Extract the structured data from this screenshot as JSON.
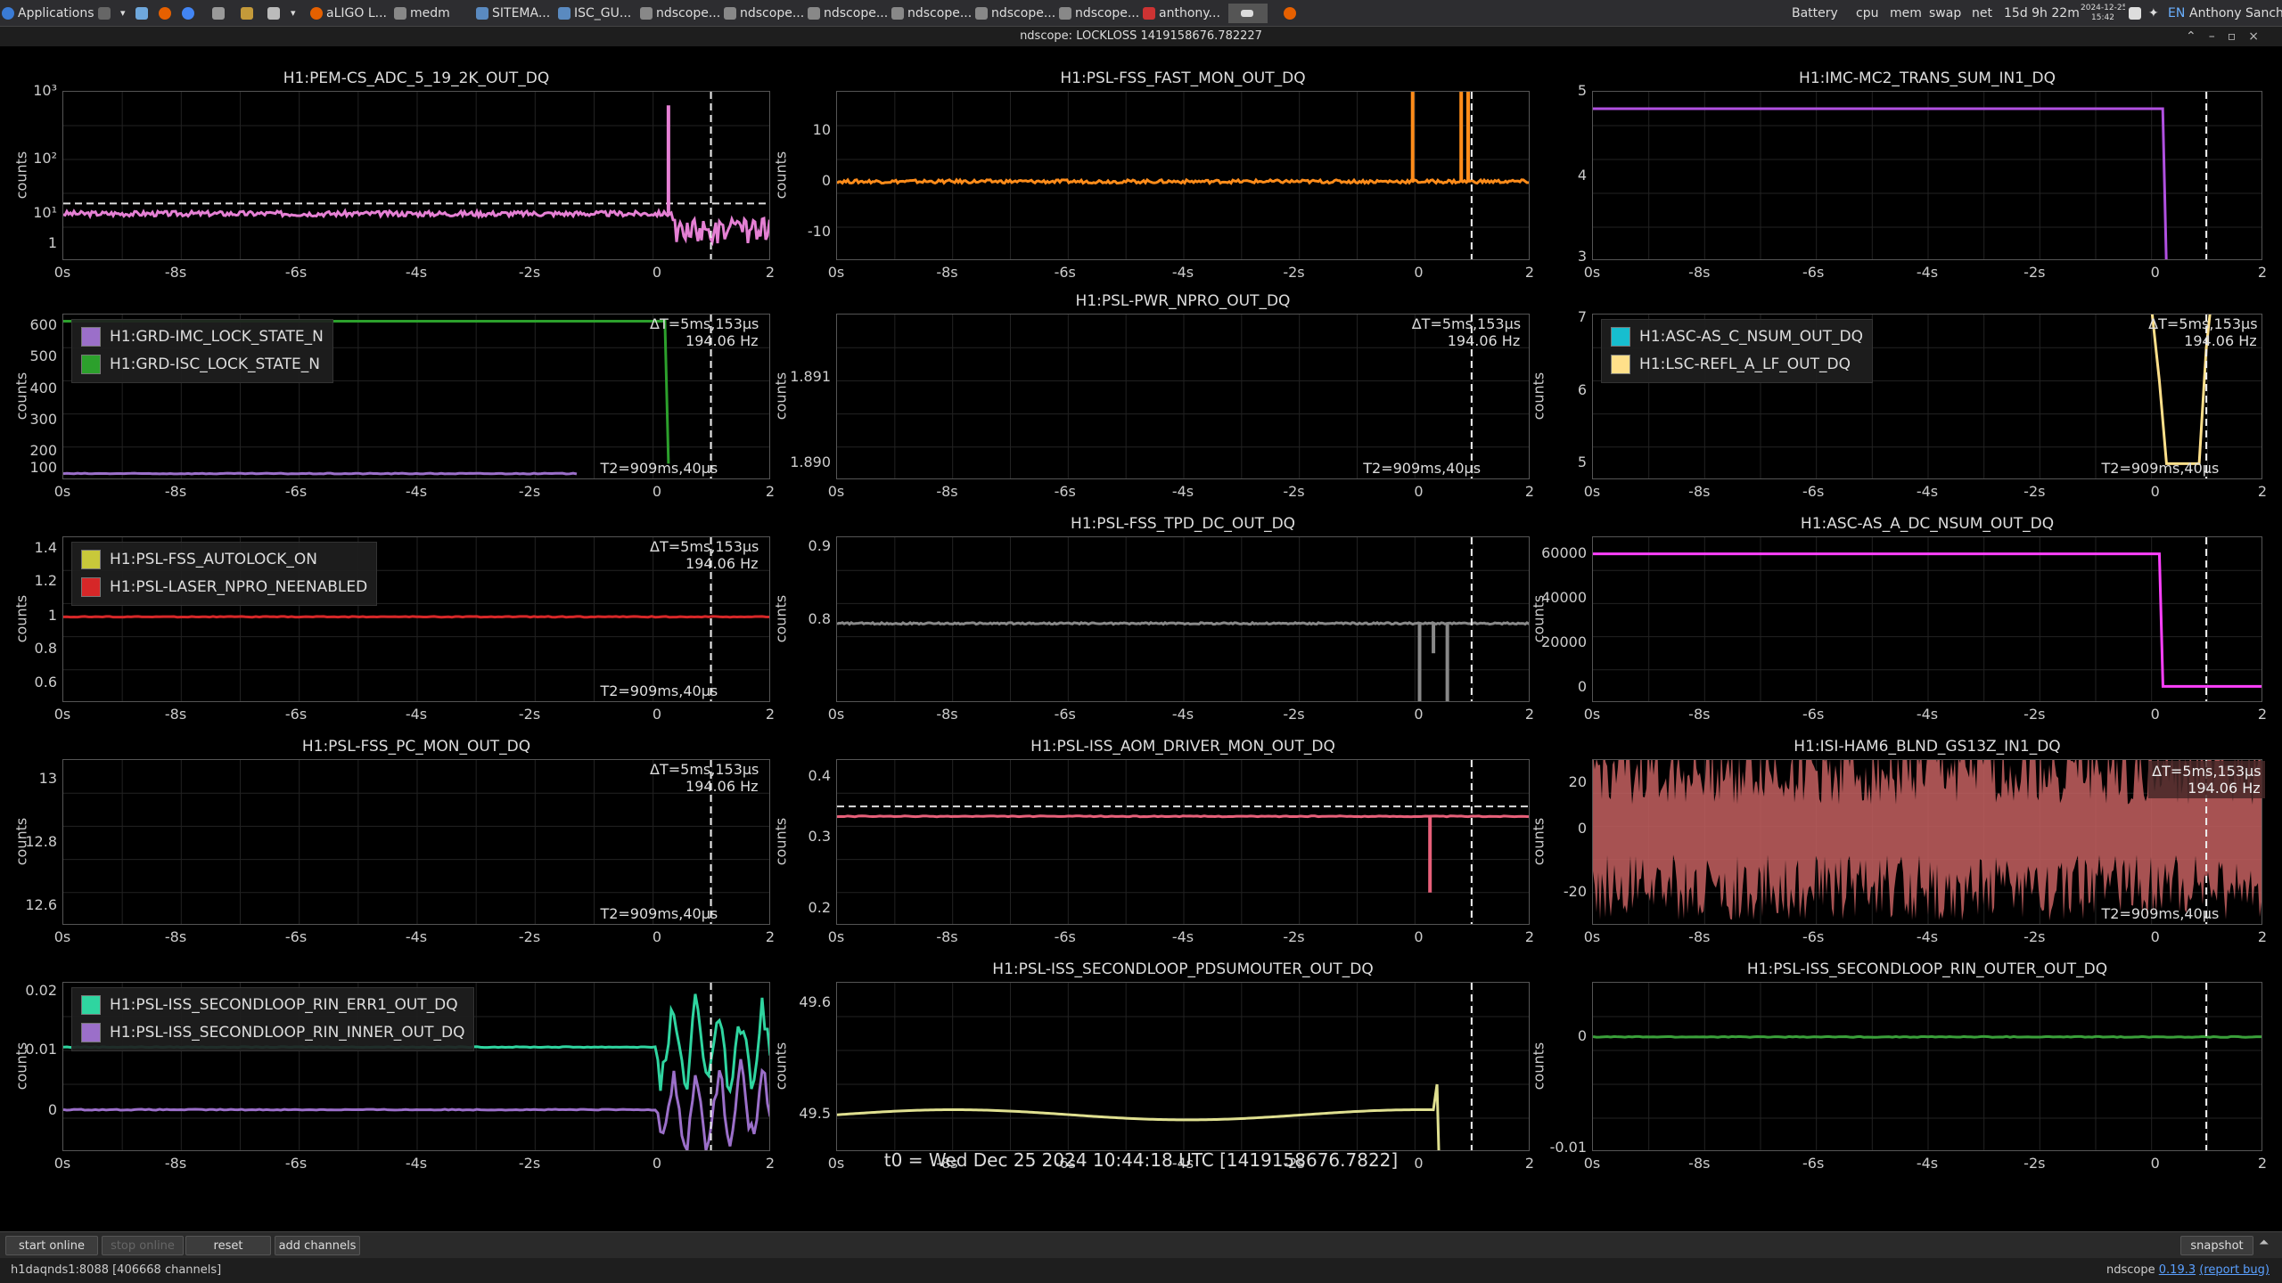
{
  "taskbar": {
    "applications": "Applications",
    "tabs": [
      "aLIGO L...",
      "medm",
      "SITEMA...",
      "ISC_GU...",
      "ndscope...",
      "ndscope...",
      "ndscope...",
      "ndscope...",
      "ndscope...",
      "ndscope...",
      "anthony..."
    ],
    "indicators": [
      "Battery",
      "cpu",
      "mem",
      "swap",
      "net"
    ],
    "uptime": "15d 9h 22m",
    "date": "2024-12-25",
    "time": "15:42",
    "lang": "EN",
    "user": "Anthony Sanchez"
  },
  "window": {
    "title": "ndscope: LOCKLOSS 1419158676.782227"
  },
  "xaxis": {
    "ticks": [
      "0s",
      "-8s",
      "-6s",
      "-4s",
      "-2s",
      "0",
      "2"
    ]
  },
  "cursor": {
    "dt": "ΔT=",
    "dt_val": "5ms,153μs",
    "freq": "194.06 Hz",
    "t2": "T2=909ms,40μs"
  },
  "plots": [
    {
      "id": "p00",
      "title": "H1:PEM-CS_ADC_5_19_2K_OUT_DQ",
      "ylabel": "counts",
      "yticks": [
        {
          "v": 1,
          "t": "10³"
        },
        {
          "v": 0.6,
          "t": "10²"
        },
        {
          "v": 0.28,
          "t": "10¹"
        },
        {
          "v": 0.1,
          "t": "1"
        }
      ],
      "series": [
        {
          "color": "#e580d4",
          "kind": "noise",
          "y": 0.28,
          "amp": 0.03,
          "after": "block",
          "block": [
            0.18,
            0.02
          ],
          "spike": [
            {
              "x": 0.855,
              "to": 0.92
            }
          ]
        }
      ],
      "hline": 0.34
    },
    {
      "id": "p01",
      "title": "H1:PSL-FSS_FAST_MON_OUT_DQ",
      "ylabel": "counts",
      "yticks": [
        {
          "v": 0.77,
          "t": "10"
        },
        {
          "v": 0.47,
          "t": "0"
        },
        {
          "v": 0.17,
          "t": "-10"
        }
      ],
      "series": [
        {
          "color": "#ff8c1a",
          "kind": "noise",
          "y": 0.47,
          "amp": 0.02,
          "spike": [
            {
              "x": 0.83,
              "to": 1
            },
            {
              "x": 0.9,
              "to": 1
            },
            {
              "x": 0.91,
              "to": 1
            }
          ]
        }
      ]
    },
    {
      "id": "p02",
      "title": "H1:IMC-MC2_TRANS_SUM_IN1_DQ",
      "ylabel": "",
      "yticks": [
        {
          "v": 1,
          "t": "5"
        },
        {
          "v": 0.5,
          "t": "4"
        },
        {
          "v": 0.02,
          "t": "3"
        }
      ],
      "series": [
        {
          "color": "#b050e0",
          "kind": "step",
          "y": 0.9,
          "dropX": 0.85,
          "dropTo": 0
        }
      ]
    },
    {
      "id": "p10",
      "title": "",
      "ylabel": "counts",
      "yticks": [
        {
          "v": 0.93,
          "t": "600"
        },
        {
          "v": 0.74,
          "t": "500"
        },
        {
          "v": 0.55,
          "t": "400"
        },
        {
          "v": 0.36,
          "t": "300"
        },
        {
          "v": 0.17,
          "t": "200"
        },
        {
          "v": 0.07,
          "t": "100"
        }
      ],
      "legend": [
        {
          "color": "#9b6fc9",
          "name": "H1:GRD-IMC_LOCK_STATE_N"
        },
        {
          "color": "#2ca02c",
          "name": "H1:GRD-ISC_LOCK_STATE_N"
        }
      ],
      "series": [
        {
          "color": "#2ca02c",
          "kind": "step",
          "y": 0.96,
          "dropX": 0.85,
          "dropTo": 0.1,
          "end": 0.9
        },
        {
          "color": "#9b6fc9",
          "kind": "flat",
          "y": 0.04,
          "end": 0.73
        }
      ]
    },
    {
      "id": "p11",
      "title": "H1:PSL-PWR_NPRO_OUT_DQ",
      "ylabel": "counts",
      "yticks": [
        {
          "v": 0.62,
          "t": "1.891"
        },
        {
          "v": 0.1,
          "t": "1.890"
        }
      ],
      "series": []
    },
    {
      "id": "p12",
      "title": "",
      "ylabel": "counts",
      "yticks": [
        {
          "v": 0.98,
          "t": "7"
        },
        {
          "v": 0.54,
          "t": "6"
        },
        {
          "v": 0.1,
          "t": "5"
        }
      ],
      "legend": [
        {
          "color": "#17becf",
          "name": "H1:ASC-AS_C_NSUM_OUT_DQ"
        },
        {
          "color": "#ffe08a",
          "name": "H1:LSC-REFL_A_LF_OUT_DQ"
        }
      ],
      "series": [
        {
          "color": "#ffe08a",
          "kind": "dip",
          "x1": 0.845,
          "x2": 0.915
        }
      ]
    },
    {
      "id": "p20",
      "title": "",
      "ylabel": "counts",
      "yticks": [
        {
          "v": 0.93,
          "t": "1.4"
        },
        {
          "v": 0.73,
          "t": "1.2"
        },
        {
          "v": 0.52,
          "t": "1"
        },
        {
          "v": 0.32,
          "t": "0.8"
        },
        {
          "v": 0.12,
          "t": "0.6"
        }
      ],
      "legend": [
        {
          "color": "#c8c83a",
          "name": "H1:PSL-FSS_AUTOLOCK_ON"
        },
        {
          "color": "#d62728",
          "name": "H1:PSL-LASER_NPRO_NEENABLED"
        }
      ],
      "series": [
        {
          "color": "#d62728",
          "kind": "flat",
          "y": 0.52,
          "end": 1
        }
      ]
    },
    {
      "id": "p21",
      "title": "H1:PSL-FSS_TPD_DC_OUT_DQ",
      "ylabel": "counts",
      "yticks": [
        {
          "v": 0.94,
          "t": "0.9"
        },
        {
          "v": 0.5,
          "t": "0.8"
        }
      ],
      "series": [
        {
          "color": "#888888",
          "kind": "noise",
          "y": 0.48,
          "amp": 0.01,
          "spike": [
            {
              "x": 0.84,
              "to": 0.0
            },
            {
              "x": 0.86,
              "to": 0.3
            },
            {
              "x": 0.88,
              "to": 0.0
            }
          ]
        }
      ]
    },
    {
      "id": "p22",
      "title": "H1:ASC-AS_A_DC_NSUM_OUT_DQ",
      "ylabel": "counts",
      "yticks": [
        {
          "v": 0.9,
          "t": "60000"
        },
        {
          "v": 0.63,
          "t": "40000"
        },
        {
          "v": 0.36,
          "t": "20000"
        },
        {
          "v": 0.09,
          "t": "0"
        }
      ],
      "series": [
        {
          "color": "#ff40ff",
          "kind": "step",
          "y": 0.9,
          "dropX": 0.845,
          "dropTo": 0.1
        }
      ]
    },
    {
      "id": "p30",
      "title": "H1:PSL-FSS_PC_MON_OUT_DQ",
      "ylabel": "counts",
      "yticks": [
        {
          "v": 0.88,
          "t": "13"
        },
        {
          "v": 0.5,
          "t": "12.8"
        },
        {
          "v": 0.12,
          "t": "12.6"
        }
      ],
      "series": []
    },
    {
      "id": "p31",
      "title": "H1:PSL-ISS_AOM_DRIVER_MON_OUT_DQ",
      "ylabel": "counts",
      "yticks": [
        {
          "v": 0.9,
          "t": "0.4"
        },
        {
          "v": 0.53,
          "t": "0.3"
        },
        {
          "v": 0.1,
          "t": "0.2"
        }
      ],
      "series": [
        {
          "color": "#e8607a",
          "kind": "flat",
          "y": 0.66,
          "end": 1,
          "spike": [
            {
              "x": 0.855,
              "to": 0.2
            }
          ]
        }
      ],
      "hline": 0.72
    },
    {
      "id": "p32",
      "title": "H1:ISI-HAM6_BLND_GS13Z_IN1_DQ",
      "ylabel": "counts",
      "yticks": [
        {
          "v": 0.86,
          "t": "20"
        },
        {
          "v": 0.58,
          "t": "0"
        },
        {
          "v": 0.2,
          "t": "-20"
        }
      ],
      "series": [
        {
          "color": "#c46060",
          "kind": "fill"
        }
      ]
    },
    {
      "id": "p40",
      "title": "",
      "ylabel": "counts",
      "yticks": [
        {
          "v": 0.95,
          "t": "0.02"
        },
        {
          "v": 0.6,
          "t": "0.01"
        },
        {
          "v": 0.24,
          "t": "0"
        }
      ],
      "legend": [
        {
          "color": "#2fd5a0",
          "name": "H1:PSL-ISS_SECONDLOOP_RIN_ERR1_OUT_DQ"
        },
        {
          "color": "#9b6fc9",
          "name": "H1:PSL-ISS_SECONDLOOP_RIN_INNER_OUT_DQ"
        }
      ],
      "series": [
        {
          "color": "#2fd5a0",
          "kind": "flat",
          "y": 0.62,
          "end": 0.84,
          "osc": true
        },
        {
          "color": "#9b6fc9",
          "kind": "flat",
          "y": 0.25,
          "end": 0.84,
          "osc": true
        }
      ]
    },
    {
      "id": "p41",
      "title": "H1:PSL-ISS_SECONDLOOP_PDSUMOUTER_OUT_DQ",
      "ylabel": "counts",
      "yticks": [
        {
          "v": 0.88,
          "t": "49.6"
        },
        {
          "v": 0.22,
          "t": "49.5"
        }
      ],
      "series": [
        {
          "color": "#e0e090",
          "kind": "wave",
          "y": 0.22,
          "end": 0.86
        }
      ]
    },
    {
      "id": "p42",
      "title": "H1:PSL-ISS_SECONDLOOP_RIN_OUTER_OUT_DQ",
      "ylabel": "counts",
      "yticks": [
        {
          "v": 0.68,
          "t": "0"
        },
        {
          "v": 0.02,
          "t": "-0.01"
        }
      ],
      "series": [
        {
          "color": "#3aa03a",
          "kind": "flat",
          "y": 0.68,
          "end": 1,
          "osc": true
        }
      ]
    }
  ],
  "t0": "t0 = Wed Dec 25 2024 10:44:18 UTC [1419158676.7822]",
  "buttons": {
    "start_online": "start online",
    "stop_online": "stop online",
    "reset": "reset",
    "add_channels": "add channels",
    "snapshot": "snapshot"
  },
  "status": {
    "server": "h1daqnds1:8088  [406668 channels]",
    "version_prefix": "ndscope ",
    "version": "0.19.3",
    "report": "(report bug)"
  }
}
